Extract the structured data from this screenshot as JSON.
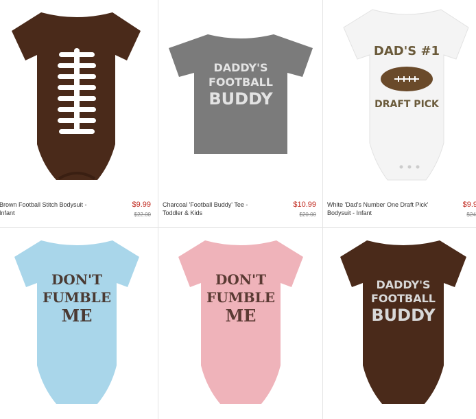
{
  "products": [
    {
      "name": "Brown Football Stitch Bodysuit - Infant",
      "price": "$9.99",
      "was": "$22.00",
      "color": "#4a2a1a"
    },
    {
      "name": "Charcoal 'Football Buddy' Tee - Toddler & Kids",
      "price": "$10.99",
      "was": "$20.00",
      "color": "#7b7b7b",
      "print": [
        "DADDY'S",
        "FOOTBALL",
        "BUDDY"
      ]
    },
    {
      "name": "White 'Dad's Number One Draft Pick' Bodysuit - Infant",
      "price": "$9.9",
      "was": "$24.",
      "color": "#f4f4f4",
      "print": [
        "DAD'S #1",
        "DRAFT PICK"
      ]
    },
    {
      "color": "#a9d6ea",
      "print": [
        "DON'T",
        "FUMBLE",
        "ME"
      ]
    },
    {
      "color": "#efb3ba",
      "print": [
        "DON'T",
        "FUMBLE",
        "ME"
      ]
    },
    {
      "color": "#4a2a1a",
      "print": [
        "DADDY'S",
        "FOOTBALL",
        "BUDDY"
      ]
    }
  ]
}
